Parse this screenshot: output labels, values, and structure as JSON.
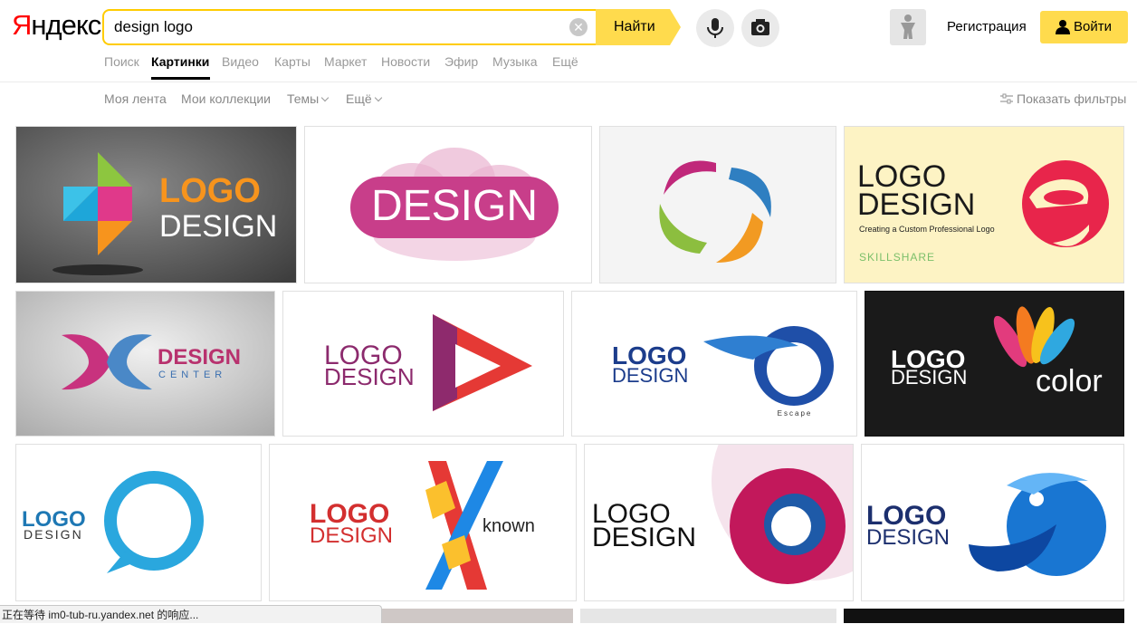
{
  "header": {
    "logo_first": "Я",
    "logo_rest": "ндекс",
    "search_value": "design logo",
    "find_label": "Найти",
    "register_label": "Регистрация",
    "login_label": "Войти"
  },
  "services": [
    {
      "label": "Поиск"
    },
    {
      "label": "Картинки",
      "active": true
    },
    {
      "label": "Видео"
    },
    {
      "label": "Карты"
    },
    {
      "label": "Маркет"
    },
    {
      "label": "Новости"
    },
    {
      "label": "Эфир"
    },
    {
      "label": "Музыка"
    },
    {
      "label": "Ещё"
    }
  ],
  "subnav": {
    "feed": "Моя лента",
    "collections": "Мои коллекции",
    "themes": "Темы",
    "more": "Ещё",
    "filters": "Показать фильтры"
  },
  "tiles": {
    "t1": {
      "line1": "LOGO",
      "line2": "DESIGN"
    },
    "t2": {
      "line1": "DESIGN"
    },
    "t4": {
      "line1": "LOGO",
      "line2": "DESIGN",
      "line3": "Creating a Custom Professional Logo",
      "line4": "SKILLSHARE"
    },
    "t5": {
      "line1": "DESIGN",
      "line2": "CENTER"
    },
    "t6": {
      "line1": "LOGO",
      "line2": "DESIGN"
    },
    "t7": {
      "line1": "LOGO",
      "line2": "DESIGN",
      "line3": "Escape"
    },
    "t8": {
      "line1": "LOGO",
      "line2": "DESIGN",
      "line3": "color"
    },
    "t9": {
      "line1": "LOGO",
      "line2": "DESIGN"
    },
    "t10": {
      "line1": "LOGO",
      "line2": "DESIGN",
      "line3": "known"
    },
    "t11": {
      "line1": "LOGO",
      "line2": "DESIGN"
    },
    "t12": {
      "line1": "LOGO",
      "line2": "DESIGN"
    }
  },
  "status_text": "正在等待 im0-tub-ru.yandex.net 的响应..."
}
